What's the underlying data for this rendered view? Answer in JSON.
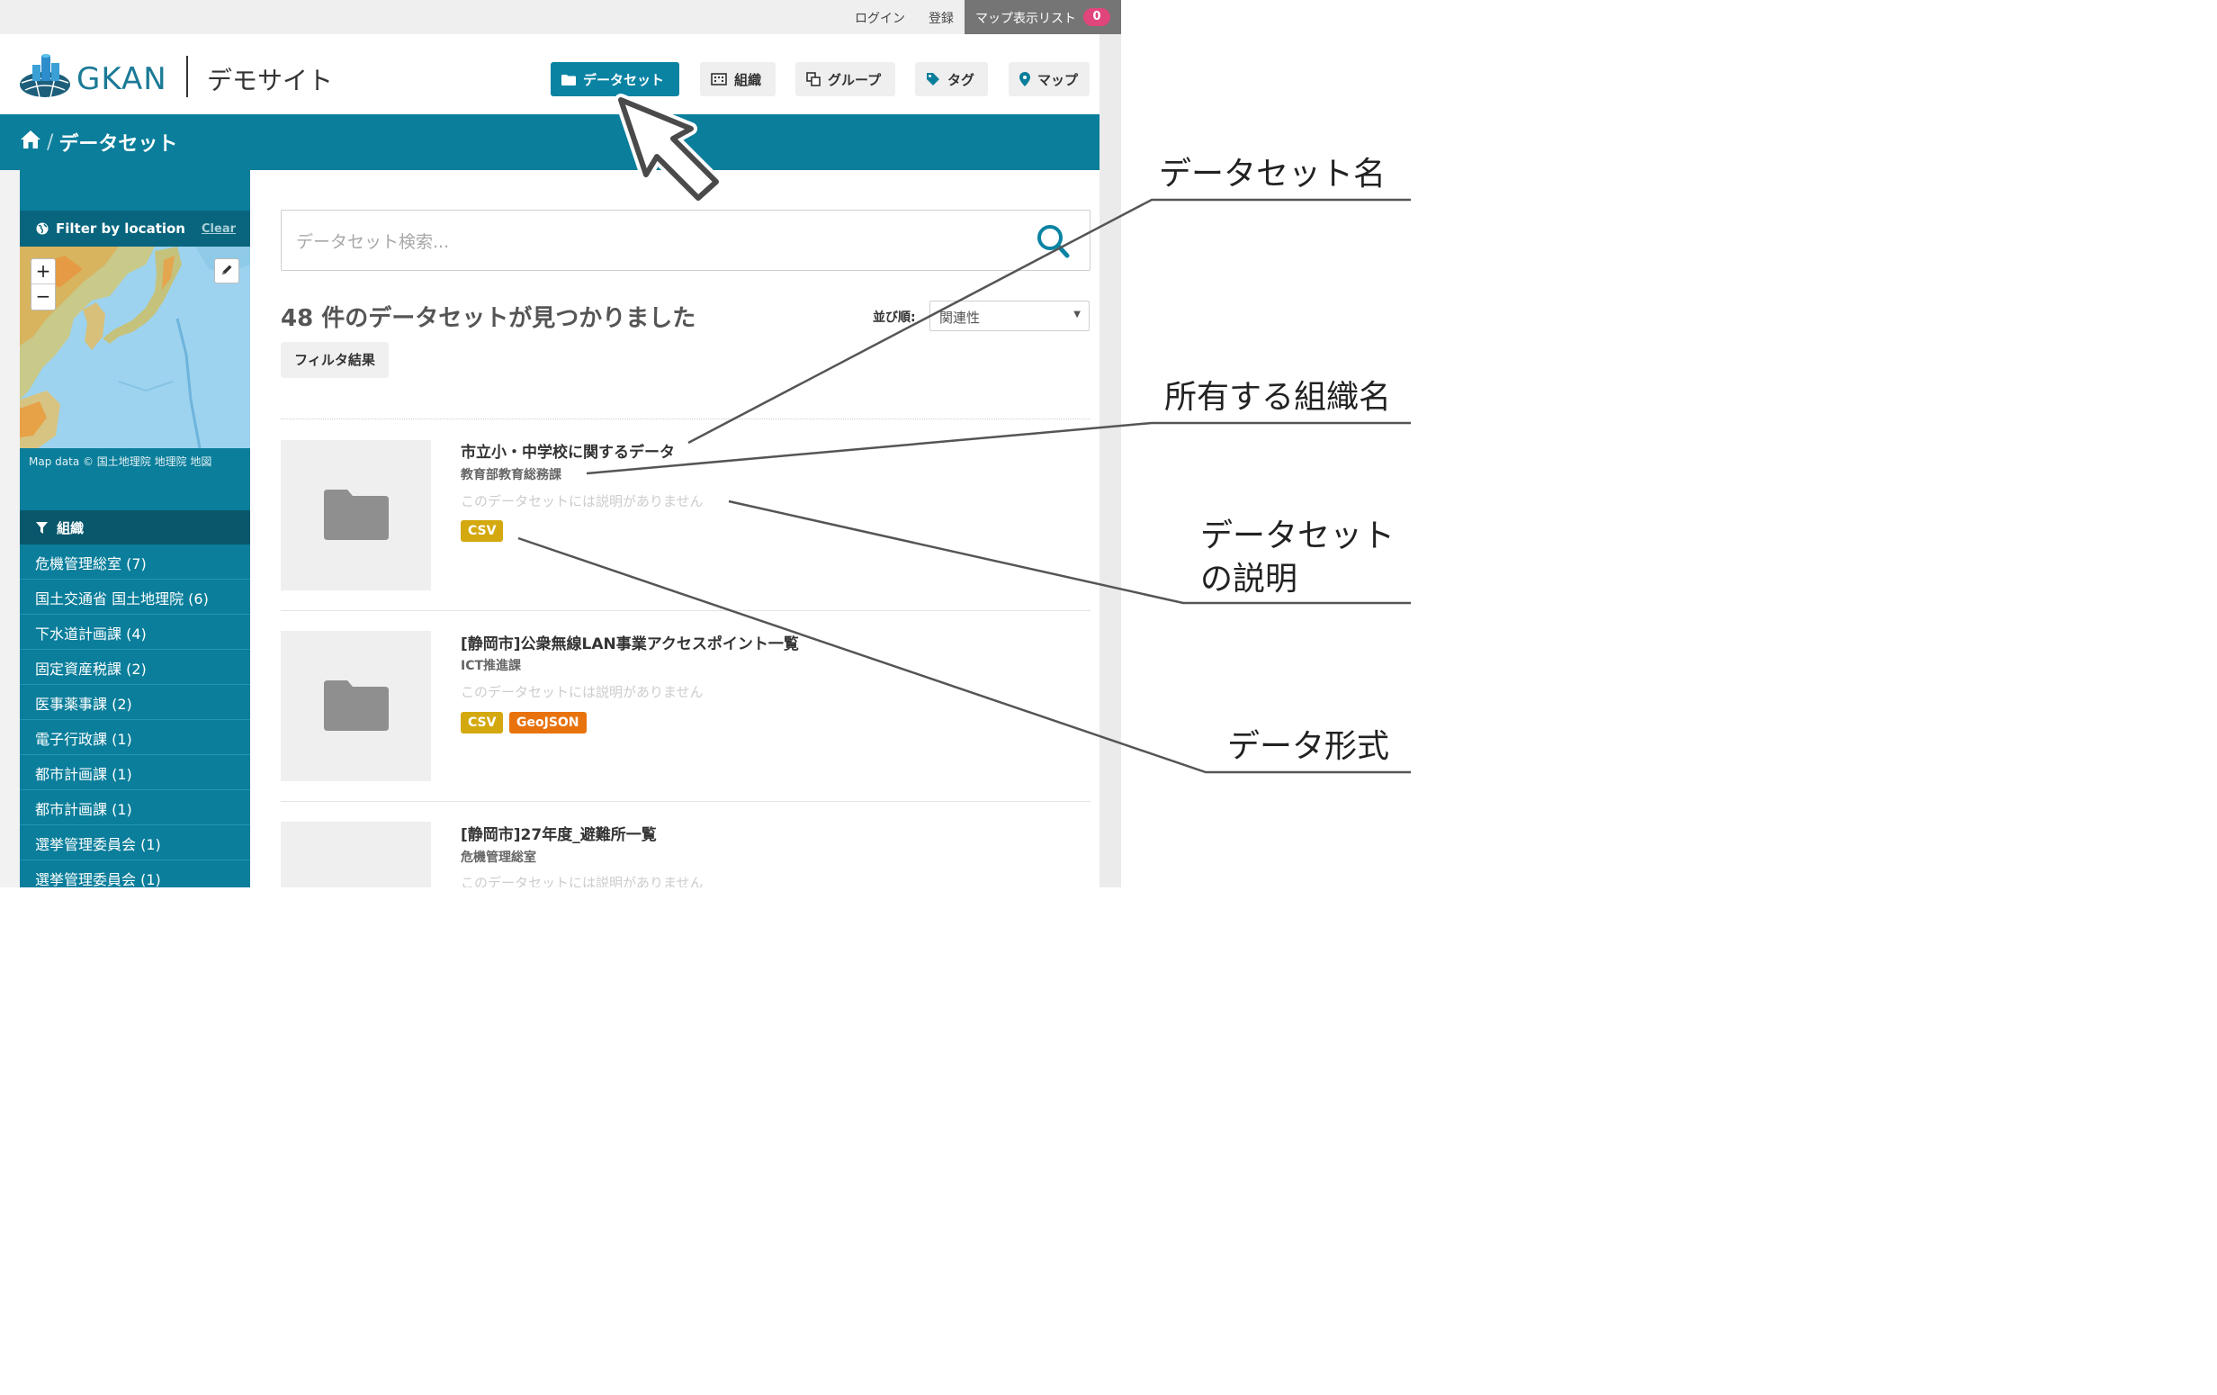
{
  "topbar": {
    "login": "ログイン",
    "register": "登録",
    "map_list_label": "マップ表示リスト",
    "map_list_count": "0"
  },
  "header": {
    "brand": "GKAN",
    "site_name": "デモサイト",
    "nav": [
      {
        "label": "データセット",
        "icon": "folder-icon",
        "active": true
      },
      {
        "label": "組織",
        "icon": "building-icon",
        "active": false
      },
      {
        "label": "グループ",
        "icon": "group-icon",
        "active": false
      },
      {
        "label": "タグ",
        "icon": "tag-icon",
        "active": false
      },
      {
        "label": "マップ",
        "icon": "map-marker-icon",
        "active": false
      }
    ]
  },
  "breadcrumb": {
    "home_icon": "home-icon",
    "separator": "/",
    "current": "データセット"
  },
  "sidebar": {
    "filter_by_location": "Filter by location",
    "clear": "Clear",
    "zoom_in": "+",
    "zoom_out": "−",
    "map_attribution": "Map data © 国土地理院 地理院 地図",
    "facet_title": "組織",
    "facets": [
      "危機管理総室 (7)",
      "国土交通省 国土地理院 (6)",
      "下水道計画課 (4)",
      "固定資産税課 (2)",
      "医事薬事課 (2)",
      "電子行政課 (1)",
      "都市計画課 (1)",
      "都市計画課 (1)",
      "選挙管理委員会 (1)",
      "選挙管理委員会 (1)"
    ]
  },
  "main": {
    "search_placeholder": "データセット検索...",
    "results_title": "48 件のデータセットが見つかりました",
    "sort_label": "並び順:",
    "sort_value": "関連性",
    "filter_results": "フィルタ結果",
    "datasets": [
      {
        "title": "市立小・中学校に関するデータ",
        "org": "教育部教育総務課",
        "description": "このデータセットには説明がありません",
        "formats": [
          "CSV"
        ]
      },
      {
        "title": "[静岡市]公衆無線LAN事業アクセスポイント一覧",
        "org": "ICT推進課",
        "description": "このデータセットには説明がありません",
        "formats": [
          "CSV",
          "GeoJSON"
        ]
      },
      {
        "title": "[静岡市]27年度_避難所一覧",
        "org": "危機管理総室",
        "description": "このデータセットには説明がありません",
        "formats": []
      }
    ]
  },
  "annotations": {
    "dataset_name": "データセット名",
    "owner_org": "所有する組織名",
    "description_line1": "データセット",
    "description_line2": "の説明",
    "data_format": "データ形式"
  },
  "colors": {
    "primary": "#0a7e9b",
    "primary_dark": "#08576b",
    "csv_badge": "#d4a90f",
    "geojson_badge": "#e8720c",
    "count_badge": "#e0457b"
  }
}
